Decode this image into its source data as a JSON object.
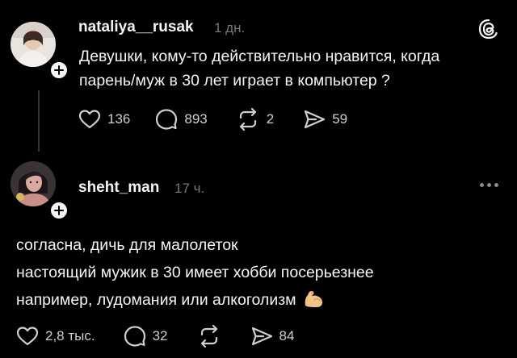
{
  "post": {
    "username": "nataliya__rusak",
    "time": "1 дн.",
    "text": "Девушки, кому-то действительно нравится, когда парень/муж в 30 лет играет в компьютер ?",
    "text_lines": [
      "Девушки, кому-то действительно нравится, когда",
      "парень/муж в 30 лет играет в компьютер ?"
    ],
    "likes": "136",
    "comments": "893",
    "reposts": "2",
    "shares": "59"
  },
  "reply": {
    "username": "sheht_man",
    "time": "17 ч.",
    "text_lines": [
      "согласна, дичь для малолеток",
      "настоящий мужик в 30 имеет хобби посерьезнее",
      "например, лудомания или алкоголизм"
    ],
    "emoji": "flexed-biceps",
    "likes": "2,8 тыс.",
    "comments": "32",
    "shares": "84"
  },
  "icons": {
    "app": "threads-logo-icon",
    "like": "heart-icon",
    "comment": "comment-icon",
    "repost": "repost-icon",
    "share": "share-icon",
    "more": "more-dots-icon",
    "follow": "plus-icon"
  },
  "colors": {
    "background": "#000000",
    "text": "#f3f5f7",
    "muted": "#777777",
    "thread_line": "#333638"
  }
}
